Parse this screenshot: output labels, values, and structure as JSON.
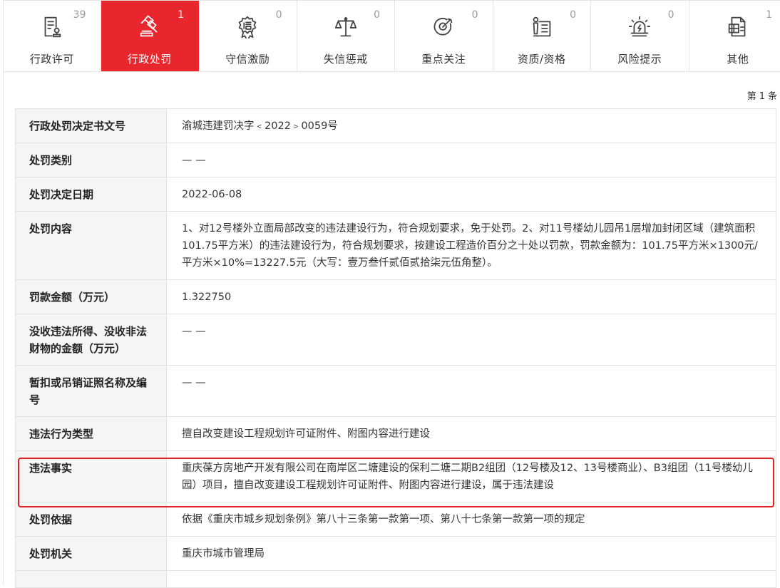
{
  "tabs": [
    {
      "label": "行政许可",
      "count": "39",
      "icon": "document-stamp-icon",
      "active": false
    },
    {
      "label": "行政处罚",
      "count": "1",
      "icon": "gavel-icon",
      "active": true
    },
    {
      "label": "守信激励",
      "count": "0",
      "icon": "credit-seal-icon",
      "active": false
    },
    {
      "label": "失信惩戒",
      "count": "0",
      "icon": "balance-scale-icon",
      "active": false
    },
    {
      "label": "重点关注",
      "count": "0",
      "icon": "target-icon",
      "active": false
    },
    {
      "label": "资质/资格",
      "count": "0",
      "icon": "certificate-icon",
      "active": false
    },
    {
      "label": "风险提示",
      "count": "0",
      "icon": "alarm-light-icon",
      "active": false
    },
    {
      "label": "其他",
      "count": "1",
      "icon": "grid-document-icon",
      "active": false
    }
  ],
  "record": {
    "prefix": "第",
    "number": "1",
    "suffix": "条"
  },
  "rows": [
    {
      "key": "行政处罚决定书文号",
      "value": "渝城违建罚决字﹤2022﹥0059号"
    },
    {
      "key": "处罚类别",
      "value": "— —"
    },
    {
      "key": "处罚决定日期",
      "value": "2022-06-08"
    },
    {
      "key": "处罚内容",
      "value": "1、对12号楼外立面局部改变的违法建设行为，符合规划要求，免于处罚。2、对11号楼幼儿园吊1层增加封闭区域（建筑面积101.75平方米）的违法建设行为，符合规划要求，按建设工程造价百分之十处以罚款，罚款金额为：101.75平方米×1300元/平方米×10%=13227.5元（大写：壹万叁仟贰佰贰拾柒元伍角整）。"
    },
    {
      "key": "罚款金额（万元）",
      "value": "1.322750"
    },
    {
      "key": "没收违法所得、没收非法财物的金额（万元）",
      "value": "— —"
    },
    {
      "key": "暂扣或吊销证照名称及编号",
      "value": "— —"
    },
    {
      "key": "违法行为类型",
      "value": "擅自改变建设工程规划许可证附件、附图内容进行建设"
    },
    {
      "key": "违法事实",
      "value": "重庆葆方房地产开发有限公司在南岸区二塘建设的保利二塘二期B2组团（12号楼及12、13号楼商业）、B3组团（11号楼幼儿园）项目，擅自改变建设工程规划许可证附件、附图内容进行建设，属于违法建设"
    },
    {
      "key": "处罚依据",
      "value": "依据《重庆市城乡规划条例》第八十三条第一款第一项、第八十七条第一款第一项的规定"
    },
    {
      "key": "处罚机关",
      "value": "重庆市城市管理局"
    }
  ],
  "colors": {
    "accent": "#e8262e",
    "highlight": "#e02020",
    "key_background": "#f5f5f5",
    "border": "#e3e3e3"
  }
}
